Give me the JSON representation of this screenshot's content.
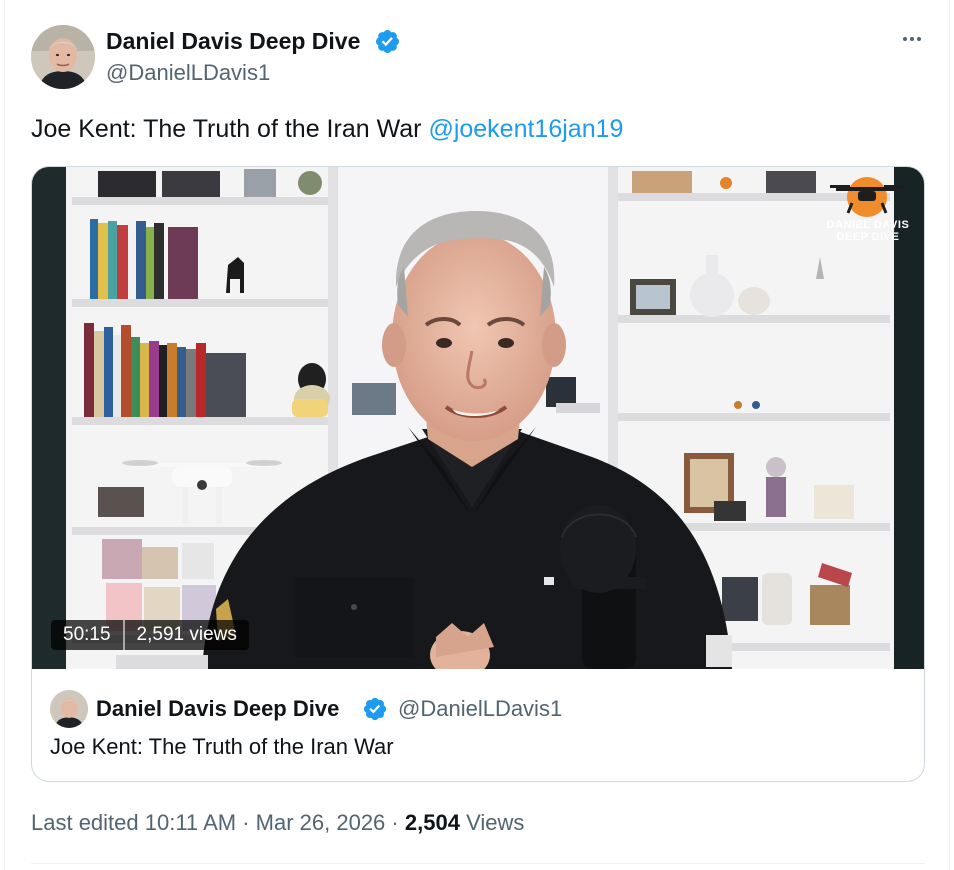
{
  "author": {
    "name": "Daniel Davis Deep Dive",
    "handle": "@DanielLDavis1",
    "verified": true,
    "avatar_icon": "profile-photo"
  },
  "menu": {
    "icon": "more-horizontal-icon"
  },
  "tweet": {
    "text": "Joe Kent: The Truth of the Iran War",
    "mention": "@joekent16jan19"
  },
  "video": {
    "duration": "50:15",
    "views": "2,591 views",
    "brand_line1": "DANIEL DAVIS",
    "brand_line2": "DEEP DIVE",
    "brand_icon": "drone-logo-icon"
  },
  "card": {
    "name": "Daniel Davis Deep Dive",
    "handle": "@DanielLDavis1",
    "title": "Joe Kent: The Truth of the Iran War"
  },
  "footer": {
    "edited": "Last edited 10:11 AM",
    "separator": "·",
    "date": "Mar 26, 2026",
    "views_count": "2,504",
    "views_label": "Views"
  },
  "colors": {
    "accent": "#1d9bf0",
    "text_primary": "#0f1419",
    "text_secondary": "#536471",
    "border": "#cfd9de"
  }
}
